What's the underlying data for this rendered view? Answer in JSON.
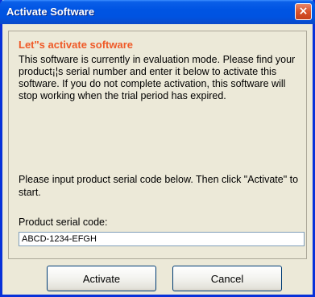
{
  "window": {
    "title": "Activate Software",
    "close_glyph": "×"
  },
  "content": {
    "heading": "Let\"s activate software",
    "description": "This software is currently in evaluation mode.  Please find your product¡¦s serial number and enter it below to activate this software.  If you do not complete activation, this software will stop working when the trial period has expired.",
    "instruction": "Please input product serial code below. Then click \"Activate\" to start.",
    "serial_label": "Product serial code:",
    "serial_value": "ABCD-1234-EFGH"
  },
  "buttons": {
    "activate_label": "Activate",
    "cancel_label": "Cancel"
  },
  "colors": {
    "titlebar": "#0054e3",
    "heading": "#ef5a28",
    "dialog_bg": "#ece9d8",
    "close_button": "#d9532c"
  },
  "icons": {
    "close": "close-icon"
  }
}
